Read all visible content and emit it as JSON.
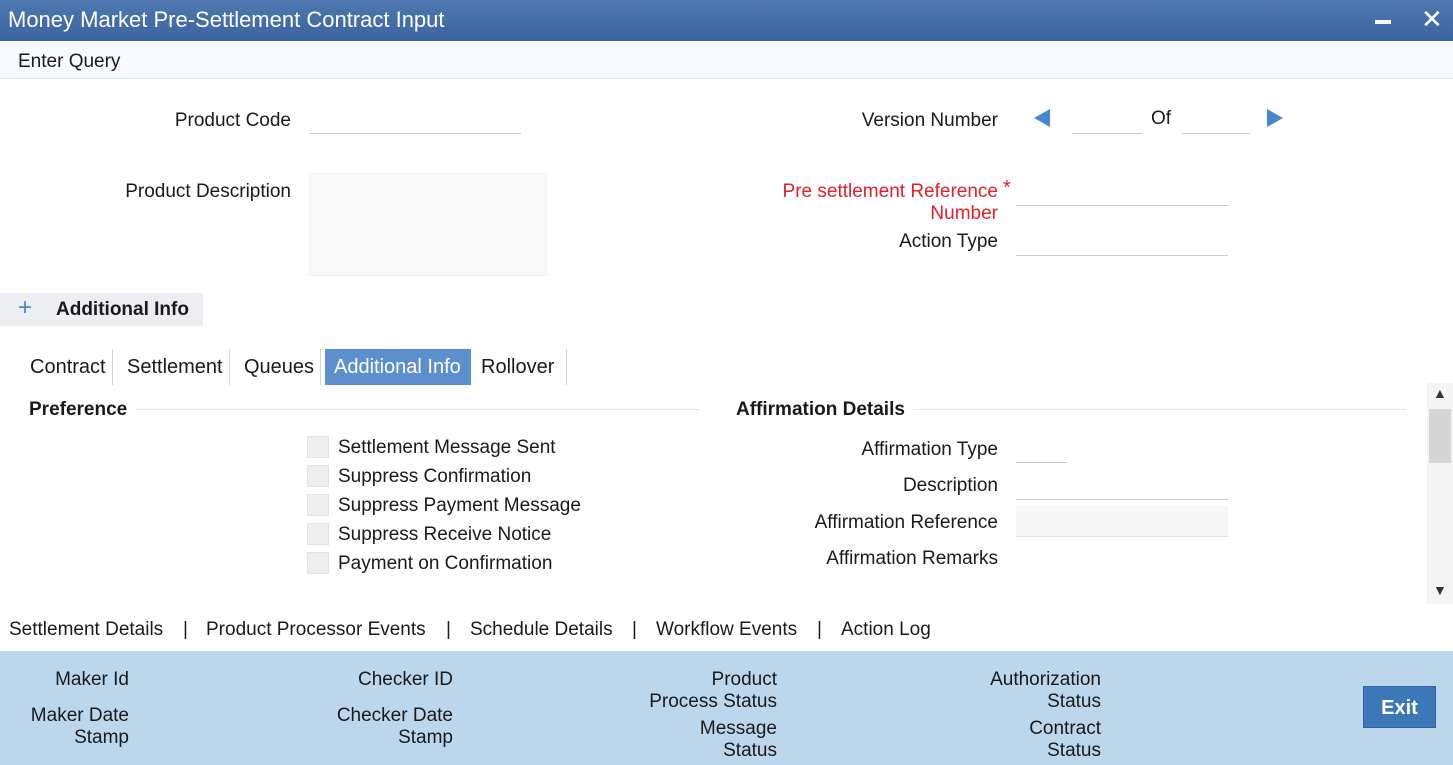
{
  "window": {
    "title": "Money Market Pre-Settlement Contract Input",
    "minimize_icon": "minimize-icon",
    "close_icon": "close-icon",
    "close_glyph": "✕"
  },
  "menu": {
    "enter_query": "Enter Query"
  },
  "header_fields": {
    "product_code_label": "Product Code",
    "product_code_value": "",
    "product_description_label": "Product Description",
    "version_number_label": "Version Number",
    "version_current": "",
    "of_label": "Of",
    "version_total": "",
    "pre_ref_label_line1": "Pre settlement Reference",
    "pre_ref_label_line2": "Number",
    "required_mark": "*",
    "pre_ref_value": "",
    "action_type_label": "Action Type",
    "action_type_value": ""
  },
  "additional_info_toggle": {
    "icon": "+",
    "label": "Additional Info"
  },
  "tabs": [
    {
      "label": "Contract",
      "active": false
    },
    {
      "label": "Settlement",
      "active": false
    },
    {
      "label": "Queues",
      "active": false
    },
    {
      "label": "Additional Info",
      "active": true
    },
    {
      "label": "Rollover",
      "active": false
    }
  ],
  "preference": {
    "heading": "Preference",
    "checkboxes": [
      {
        "label": "Settlement Message Sent",
        "checked": false
      },
      {
        "label": "Suppress Confirmation",
        "checked": false
      },
      {
        "label": "Suppress Payment Message",
        "checked": false
      },
      {
        "label": "Suppress Receive Notice",
        "checked": false
      },
      {
        "label": "Payment on Confirmation",
        "checked": false
      }
    ]
  },
  "affirmation": {
    "heading": "Affirmation Details",
    "type_label": "Affirmation Type",
    "description_label": "Description",
    "reference_label": "Affirmation Reference",
    "remarks_label": "Affirmation Remarks"
  },
  "scrollbar": {
    "up_glyph": "▲",
    "down_glyph": "▼"
  },
  "bottom_links": [
    "Settlement Details",
    "Product Processor Events",
    "Schedule Details",
    "Workflow Events",
    "Action Log"
  ],
  "separator": "|",
  "footer": {
    "maker_id": "Maker Id",
    "maker_date_line1": "Maker Date",
    "maker_date_line2": "Stamp",
    "checker_id": "Checker ID",
    "checker_date_line1": "Checker Date",
    "checker_date_line2": "Stamp",
    "product_process_line1": "Product",
    "product_process_line2": "Process Status",
    "message_status_line1": "Message",
    "message_status_line2": "Status",
    "authorization_line1": "Authorization",
    "authorization_line2": "Status",
    "contract_status_line1": "Contract",
    "contract_status_line2": "Status",
    "exit_label": "Exit"
  },
  "colors": {
    "titlebar": "#4a72ab",
    "accent": "#5d8fcf",
    "required": "#e0202a",
    "footer_bg": "#bcd6ec",
    "exit_button": "#3c78b7"
  }
}
